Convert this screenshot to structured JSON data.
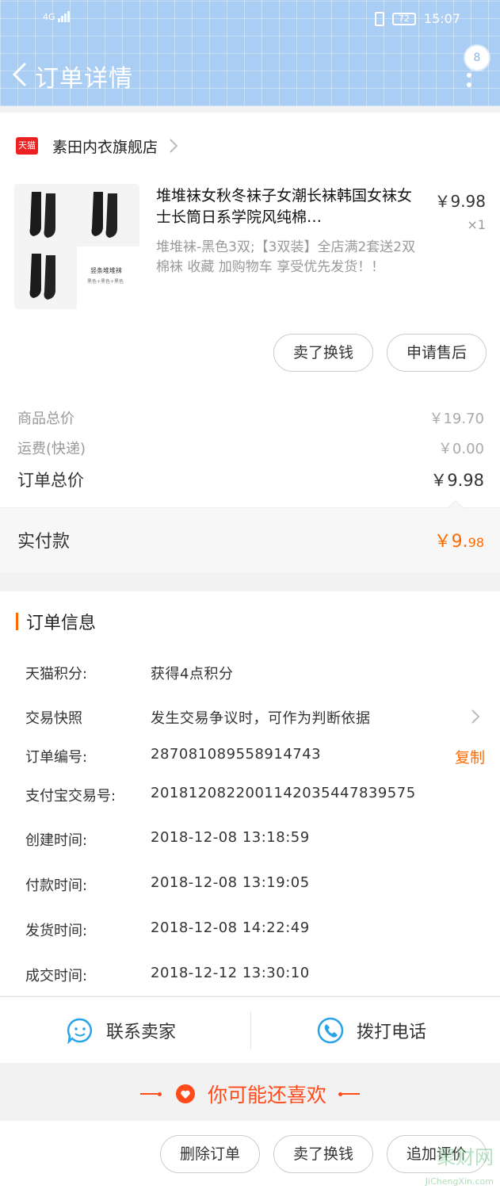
{
  "status_bar": {
    "network": "4G",
    "battery": "72",
    "time": "15:07"
  },
  "header": {
    "title": "订单详情",
    "message_count": "8"
  },
  "store": {
    "badge": "天猫",
    "name": "素田内衣旗舰店"
  },
  "product": {
    "title": "堆堆袜女秋冬袜子女潮长袜韩国女袜女士长筒日系学院风纯棉…",
    "price": "￥9.98",
    "qty": "×1",
    "sku": "堆堆袜-黑色3双;【3双装】全店满2套送2双棉袜 收藏 加购物车 享受优先发货！！",
    "thumb_caption": "竖条堆堆袜",
    "thumb_sub": "黑色+黑色+黑色"
  },
  "actions_top": {
    "sell_label": "卖了换钱",
    "after_sale_label": "申请售后"
  },
  "summary": {
    "goods_label": "商品总价",
    "goods_val": "￥19.70",
    "ship_label": "运费(快递)",
    "ship_val": "￥0.00",
    "total_label": "订单总价",
    "total_val": "￥9.98",
    "paid_label": "实付款",
    "paid_main": "￥9.",
    "paid_small": "98"
  },
  "order_info": {
    "title": "订单信息",
    "rows": [
      {
        "k": "天猫积分:",
        "v": "获得4点积分"
      },
      {
        "k": "交易快照",
        "v": "发生交易争议时，可作为判断依据"
      },
      {
        "k": "订单编号:",
        "v": "287081089558914743"
      },
      {
        "k": "支付宝交易号:",
        "v": "2018120822001142035447839575"
      },
      {
        "k": "创建时间:",
        "v": "2018-12-08 13:18:59"
      },
      {
        "k": "付款时间:",
        "v": "2018-12-08 13:19:05"
      },
      {
        "k": "发货时间:",
        "v": "2018-12-08 14:22:49"
      },
      {
        "k": "成交时间:",
        "v": "2018-12-12 13:30:10"
      }
    ],
    "copy_label": "复制"
  },
  "contact": {
    "seller_label": "联系卖家",
    "phone_label": "拨打电话"
  },
  "recommend": {
    "title": "你可能还喜欢"
  },
  "bottom_actions": {
    "delete_label": "删除订单",
    "sell_label": "卖了换钱",
    "review_label": "追加评价"
  },
  "watermark": {
    "text": "聚财网",
    "sub": "JiChengXin.com"
  },
  "colors": {
    "header": "#a9cdf3",
    "accent": "#ff6a00",
    "reco": "#ff4a1a",
    "tmall": "#ee2222"
  }
}
